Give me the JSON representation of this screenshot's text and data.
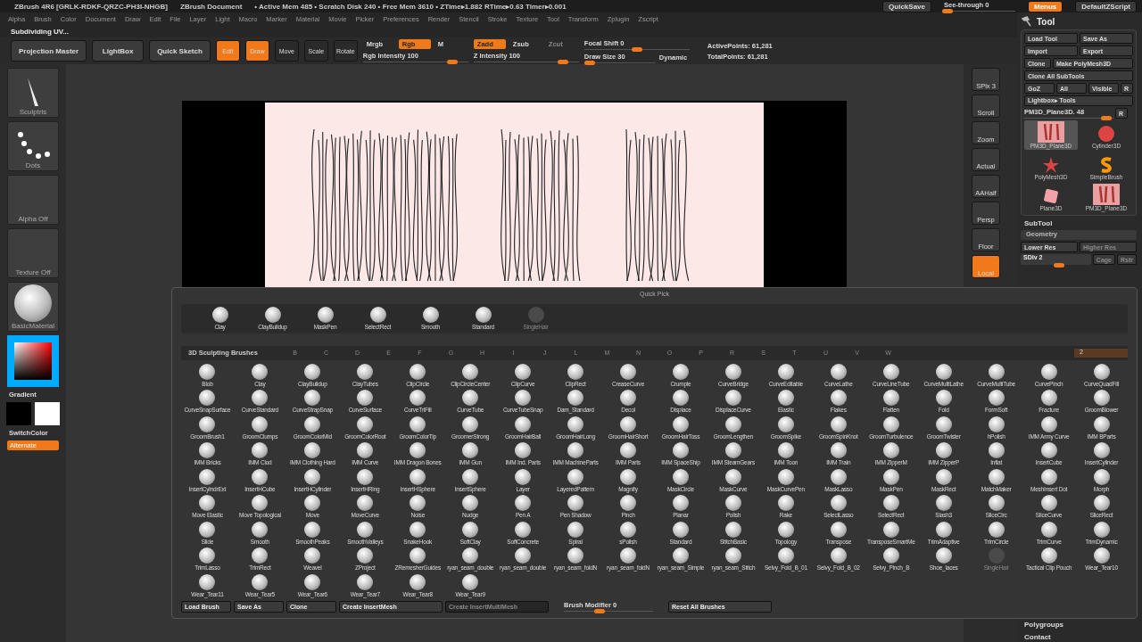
{
  "title_bar": {
    "title": "ZBrush 4R6 [GRLK-RDKF-QRZC-PH3I-NHGB]",
    "document": "ZBrush Document",
    "stats": "• Active Mem 485 • Scratch Disk 240 • Free Mem 3610 • ZTime▸1.882 RTime▸0.63 Timer▸0.001",
    "quicksave": "QuickSave",
    "see_through": {
      "label": "See-through",
      "value": "0",
      "level": 0.05
    },
    "menus_button": {
      "label": "Menus",
      "selected": true
    },
    "script_button": "DefaultZScript"
  },
  "menu_bar": [
    "Alpha",
    "Brush",
    "Color",
    "Document",
    "Draw",
    "Edit",
    "File",
    "Layer",
    "Light",
    "Macro",
    "Marker",
    "Material",
    "Movie",
    "Picker",
    "Preferences",
    "Render",
    "Stencil",
    "Stroke",
    "Texture",
    "Tool",
    "Transform",
    "Zplugin",
    "Zscript"
  ],
  "status": "Subdividing UV...",
  "toolbar": {
    "projection_master": "Projection Master",
    "lightbox": "LightBox",
    "quick_sketch": "Quick Sketch",
    "modes": [
      {
        "label": "Edit",
        "selected": true
      },
      {
        "label": "Draw",
        "selected": true
      },
      {
        "label": "Move",
        "selected": false
      },
      {
        "label": "Scale",
        "selected": false
      },
      {
        "label": "Rotate",
        "selected": false
      }
    ],
    "channels": [
      {
        "label": "Mrgb",
        "selected": false
      },
      {
        "label": "Rgb",
        "selected": true
      },
      {
        "label": "M",
        "selected": false
      }
    ],
    "depth": [
      {
        "label": "Zadd",
        "selected": true
      },
      {
        "label": "Zsub",
        "selected": false
      },
      {
        "label": "Zcut",
        "selected": false
      }
    ],
    "rgb_intensity": {
      "label": "Rgb Intensity",
      "value": "100",
      "level": 0.85
    },
    "z_intensity": {
      "label": "Z Intensity",
      "value": "100",
      "level": 0.85
    },
    "focal_shift": {
      "label": "Focal Shift",
      "value": "0",
      "level": 0.5
    },
    "draw_size": {
      "label": "Draw Size",
      "value": "30",
      "level": 0.08
    },
    "dynamic": "Dynamic",
    "active_points": "ActivePoints: 61,281",
    "total_points": "TotalPoints: 61,281"
  },
  "left_shelf": {
    "brush": "Sculptris",
    "stroke": "Dots",
    "alpha": "Alpha Off",
    "texture": "Texture Off",
    "material": "BasicMaterial",
    "gradient": "Gradient",
    "switch_color": "SwitchColor",
    "alternate": "Alternate"
  },
  "nav_buttons": [
    {
      "label": "SPix 3",
      "active": false
    },
    {
      "label": "Scroll",
      "active": false
    },
    {
      "label": "Zoom",
      "active": false
    },
    {
      "label": "Actual",
      "active": false
    },
    {
      "label": "AAHalf",
      "active": false
    },
    {
      "label": "Persp",
      "active": false
    },
    {
      "label": "Floor",
      "active": false
    },
    {
      "label": "Local",
      "active": true
    }
  ],
  "tool_panel": {
    "title": "Tool",
    "buttons": [
      "Load Tool",
      "Save As",
      "Import",
      "Export",
      "Clone",
      "Make PolyMesh3D",
      "Clone All SubTools",
      "GoZ",
      "All",
      "Visible",
      "R",
      "Lightbox▸ Tools"
    ],
    "current": {
      "label": "PM3D_Plane3D. 48",
      "level": 0.92
    },
    "reset": "R",
    "tools": [
      {
        "label": "PM3D_Plane3D",
        "kind": "hair",
        "selected": true
      },
      {
        "label": "Cylinder3D",
        "kind": "cylinder",
        "selected": false
      },
      {
        "label": "PolyMesh3D",
        "kind": "star",
        "selected": false
      },
      {
        "label": "SimpleBrush",
        "kind": "brush",
        "selected": false
      },
      {
        "label": "Plane3D",
        "kind": "plane",
        "selected": false
      },
      {
        "label": "PM3D_Plane3D",
        "kind": "hair",
        "selected": false
      }
    ],
    "subtool": "SubTool",
    "geometry": "Geometry",
    "lower_res": "Lower Res",
    "higher_res": "Higher Res",
    "sdiv": {
      "label": "SDiv 2",
      "level": 0.55
    },
    "cage": "Cage",
    "rstr": "Rstr",
    "polygroups": "Polygroups",
    "contact": "Contact"
  },
  "quick_pick": {
    "title": "Quick Pick",
    "items": [
      {
        "label": "Clay",
        "disabled": false
      },
      {
        "label": "ClayBuildup",
        "disabled": false
      },
      {
        "label": "MaskPen",
        "disabled": false
      },
      {
        "label": "SelectRect",
        "disabled": false
      },
      {
        "label": "Smooth",
        "disabled": false
      },
      {
        "label": "Standard",
        "disabled": false
      },
      {
        "label": "SingleHair",
        "disabled": true
      }
    ],
    "section": "3D Sculpting Brushes",
    "letters": [
      "B",
      "C",
      "D",
      "E",
      "F",
      "G",
      "H",
      "I",
      "J",
      "L",
      "M",
      "N",
      "O",
      "P",
      "R",
      "S",
      "T",
      "U",
      "V",
      "W"
    ],
    "page": "2",
    "brushes": [
      {
        "label": "Blob",
        "disabled": false
      },
      {
        "label": "Clay",
        "disabled": false
      },
      {
        "label": "ClayBuildup",
        "disabled": false
      },
      {
        "label": "ClayTubes",
        "disabled": false
      },
      {
        "label": "ClipCircle",
        "disabled": false
      },
      {
        "label": "ClipCircleCenter",
        "disabled": false
      },
      {
        "label": "ClipCurve",
        "disabled": false
      },
      {
        "label": "ClipRect",
        "disabled": false
      },
      {
        "label": "CreaseCurve",
        "disabled": false
      },
      {
        "label": "Crumple",
        "disabled": false
      },
      {
        "label": "CurveBridge",
        "disabled": false
      },
      {
        "label": "CurveEditable",
        "disabled": false
      },
      {
        "label": "CurveLathe",
        "disabled": false
      },
      {
        "label": "CurveLineTube",
        "disabled": false
      },
      {
        "label": "CurveMultiLathe",
        "disabled": false
      },
      {
        "label": "CurveMultiTube",
        "disabled": false
      },
      {
        "label": "CurvePinch",
        "disabled": false
      },
      {
        "label": "CurveQuadFill",
        "disabled": false
      },
      {
        "label": "CurveSnapSurface",
        "disabled": false
      },
      {
        "label": "CurveStandard",
        "disabled": false
      },
      {
        "label": "CurveStrapSnap",
        "disabled": false
      },
      {
        "label": "CurveSurface",
        "disabled": false
      },
      {
        "label": "CurveTriFill",
        "disabled": false
      },
      {
        "label": "CurveTube",
        "disabled": false
      },
      {
        "label": "CurveTubeSnap",
        "disabled": false
      },
      {
        "label": "Dam_Standard",
        "disabled": false
      },
      {
        "label": "Decol",
        "disabled": false
      },
      {
        "label": "Displace",
        "disabled": false
      },
      {
        "label": "DisplaceCurve",
        "disabled": false
      },
      {
        "label": "Elastic",
        "disabled": false
      },
      {
        "label": "Flakes",
        "disabled": false
      },
      {
        "label": "Flatten",
        "disabled": false
      },
      {
        "label": "Fold",
        "disabled": false
      },
      {
        "label": "FormSoft",
        "disabled": false
      },
      {
        "label": "Fracture",
        "disabled": false
      },
      {
        "label": "GroomBlower",
        "disabled": false
      },
      {
        "label": "GroomBrush1",
        "disabled": false
      },
      {
        "label": "GroomClumps",
        "disabled": false
      },
      {
        "label": "GroomColorMid",
        "disabled": false
      },
      {
        "label": "GroomColorRoot",
        "disabled": false
      },
      {
        "label": "GroomColorTip",
        "disabled": false
      },
      {
        "label": "GroomerStrong",
        "disabled": false
      },
      {
        "label": "GroomHairBall",
        "disabled": false
      },
      {
        "label": "GroomHairLong",
        "disabled": false
      },
      {
        "label": "GroomHairShort",
        "disabled": false
      },
      {
        "label": "GroomHairToss",
        "disabled": false
      },
      {
        "label": "GroomLengthen",
        "disabled": false
      },
      {
        "label": "GroomSpike",
        "disabled": false
      },
      {
        "label": "GroomSpinKnot",
        "disabled": false
      },
      {
        "label": "GroomTurbulence",
        "disabled": false
      },
      {
        "label": "GroomTwister",
        "disabled": false
      },
      {
        "label": "hPolish",
        "disabled": false
      },
      {
        "label": "IMM Army Curve",
        "disabled": false
      },
      {
        "label": "IMM BParts",
        "disabled": false
      },
      {
        "label": "IMM Bricks",
        "disabled": false
      },
      {
        "label": "IMM Clod",
        "disabled": false
      },
      {
        "label": "IMM Clothing Hard",
        "disabled": false
      },
      {
        "label": "IMM Curve",
        "disabled": false
      },
      {
        "label": "IMM Dragon Bones",
        "disabled": false
      },
      {
        "label": "IMM Gun",
        "disabled": false
      },
      {
        "label": "IMM Ind. Parts",
        "disabled": false
      },
      {
        "label": "IMM MachineParts",
        "disabled": false
      },
      {
        "label": "IMM Parts",
        "disabled": false
      },
      {
        "label": "IMM SpaceShip",
        "disabled": false
      },
      {
        "label": "IMM SteamGears",
        "disabled": false
      },
      {
        "label": "IMM Toon",
        "disabled": false
      },
      {
        "label": "IMM Train",
        "disabled": false
      },
      {
        "label": "IMM ZipperM",
        "disabled": false
      },
      {
        "label": "IMM ZipperP",
        "disabled": false
      },
      {
        "label": "Inflat",
        "disabled": false
      },
      {
        "label": "InsertCube",
        "disabled": false
      },
      {
        "label": "InsertCylinder",
        "disabled": false
      },
      {
        "label": "InsertCylndrExt",
        "disabled": false
      },
      {
        "label": "InsertHCube",
        "disabled": false
      },
      {
        "label": "InsertHCylinder",
        "disabled": false
      },
      {
        "label": "InsertHRing",
        "disabled": false
      },
      {
        "label": "InsertHSphere",
        "disabled": false
      },
      {
        "label": "InsertSphere",
        "disabled": false
      },
      {
        "label": "Layer",
        "disabled": false
      },
      {
        "label": "LayeredPattern",
        "disabled": false
      },
      {
        "label": "Magnify",
        "disabled": false
      },
      {
        "label": "MaskCircle",
        "disabled": false
      },
      {
        "label": "MaskCurve",
        "disabled": false
      },
      {
        "label": "MaskCurvePen",
        "disabled": false
      },
      {
        "label": "MaskLasso",
        "disabled": false
      },
      {
        "label": "MaskPen",
        "disabled": false
      },
      {
        "label": "MaskRect",
        "disabled": false
      },
      {
        "label": "MatchMaker",
        "disabled": false
      },
      {
        "label": "MeshInsert Dot",
        "disabled": false
      },
      {
        "label": "Morph",
        "disabled": false
      },
      {
        "label": "Move Elastic",
        "disabled": false
      },
      {
        "label": "Move Topological",
        "disabled": false
      },
      {
        "label": "Move",
        "disabled": false
      },
      {
        "label": "MoveCurve",
        "disabled": false
      },
      {
        "label": "Noise",
        "disabled": false
      },
      {
        "label": "Nudge",
        "disabled": false
      },
      {
        "label": "Pen A",
        "disabled": false
      },
      {
        "label": "Pen Shadow",
        "disabled": false
      },
      {
        "label": "Pinch",
        "disabled": false
      },
      {
        "label": "Planar",
        "disabled": false
      },
      {
        "label": "Polish",
        "disabled": false
      },
      {
        "label": "Rake",
        "disabled": false
      },
      {
        "label": "SelectLasso",
        "disabled": false
      },
      {
        "label": "SelectRect",
        "disabled": false
      },
      {
        "label": "Slash3",
        "disabled": false
      },
      {
        "label": "SliceCirc",
        "disabled": false
      },
      {
        "label": "SliceCurve",
        "disabled": false
      },
      {
        "label": "SliceRect",
        "disabled": false
      },
      {
        "label": "Slide",
        "disabled": false
      },
      {
        "label": "Smooth",
        "disabled": false
      },
      {
        "label": "SmoothPeaks",
        "disabled": false
      },
      {
        "label": "SmoothValleys",
        "disabled": false
      },
      {
        "label": "SnakeHook",
        "disabled": false
      },
      {
        "label": "SoftClay",
        "disabled": false
      },
      {
        "label": "SoftConcrete",
        "disabled": false
      },
      {
        "label": "Spiral",
        "disabled": false
      },
      {
        "label": "sPolish",
        "disabled": false
      },
      {
        "label": "Standard",
        "disabled": false
      },
      {
        "label": "StitchBasic",
        "disabled": false
      },
      {
        "label": "Topology",
        "disabled": false
      },
      {
        "label": "Transpose",
        "disabled": false
      },
      {
        "label": "TransposeSmartMe",
        "disabled": false
      },
      {
        "label": "TrimAdaptive",
        "disabled": false
      },
      {
        "label": "TrimCircle",
        "disabled": false
      },
      {
        "label": "TrimCurve",
        "disabled": false
      },
      {
        "label": "TrimDynamic",
        "disabled": false
      },
      {
        "label": "TrimLasso",
        "disabled": false
      },
      {
        "label": "TrimRect",
        "disabled": false
      },
      {
        "label": "Weavel",
        "disabled": false
      },
      {
        "label": "ZProject",
        "disabled": false
      },
      {
        "label": "ZRemesherGuides",
        "disabled": false
      },
      {
        "label": "ryan_seam_double",
        "disabled": false
      },
      {
        "label": "ryan_seam_double",
        "disabled": false
      },
      {
        "label": "ryan_seam_foldN",
        "disabled": false
      },
      {
        "label": "ryan_seam_foldN",
        "disabled": false
      },
      {
        "label": "ryan_seam_Simple",
        "disabled": false
      },
      {
        "label": "ryan_seam_Stitch",
        "disabled": false
      },
      {
        "label": "Selvy_Fold_B_01",
        "disabled": false
      },
      {
        "label": "Selvy_Fold_B_02",
        "disabled": false
      },
      {
        "label": "Selvy_Pinch_B",
        "disabled": false
      },
      {
        "label": "Shoe_laces",
        "disabled": false
      },
      {
        "label": "SingleHair",
        "disabled": true
      },
      {
        "label": "Tactical Clip Pouch",
        "disabled": false
      },
      {
        "label": "Wear_Tear10",
        "disabled": false
      },
      {
        "label": "Wear_Tear11",
        "disabled": false
      },
      {
        "label": "Wear_Tear5",
        "disabled": false
      },
      {
        "label": "Wear_Tear6",
        "disabled": false
      },
      {
        "label": "Wear_Tear7",
        "disabled": false
      },
      {
        "label": "Wear_Tear8",
        "disabled": false
      },
      {
        "label": "Wear_Tear9",
        "disabled": false
      }
    ],
    "footer": [
      {
        "label": "Load Brush",
        "kind": "button",
        "disabled": false
      },
      {
        "label": "Save As",
        "kind": "button",
        "disabled": false
      },
      {
        "label": "Clone",
        "kind": "button",
        "disabled": false
      },
      {
        "label": "Create InsertMesh",
        "kind": "button",
        "disabled": false
      },
      {
        "label": "Create InsertMultiMesh",
        "kind": "button",
        "disabled": true
      },
      {
        "label": "Brush Modifier",
        "value": "0",
        "kind": "slider",
        "level": 0.4,
        "disabled": false
      },
      {
        "label": "Reset All Brushes",
        "kind": "button",
        "disabled": false
      }
    ]
  }
}
